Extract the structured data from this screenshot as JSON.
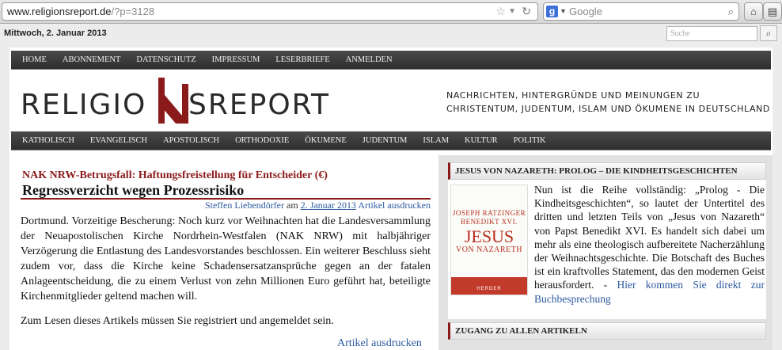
{
  "browser": {
    "url_host": "www.religionsreport.de",
    "url_path": "/?p=3128",
    "search_engine": "Google",
    "icons": [
      "star-icon",
      "dropdown-icon",
      "reload-icon",
      "google-icon",
      "magnifier-icon",
      "home-icon",
      "bookmark-icon"
    ]
  },
  "topbar": {
    "date": "Mittwoch, 2. Januar 2013",
    "search_placeholder": "Suche"
  },
  "nav_top": [
    "HOME",
    "ABONNEMENT",
    "DATENSCHUTZ",
    "IMPRESSUM",
    "LESERBRIEFE",
    "ANMELDEN"
  ],
  "logo": {
    "part1": "RELIGIO",
    "part2": "SREPORT",
    "mark": "N",
    "mark_color": "#8b1a1a"
  },
  "tagline": "Nachrichten, Hintergründe und Meinungen zu Christentum, Judentum, Islam und Ökumene in Deutschland",
  "nav_categories": [
    "KATHOLISCH",
    "EVANGELISCH",
    "APOSTOLISCH",
    "ORTHODOXIE",
    "ÖKUMENE",
    "JUDENTUM",
    "ISLAM",
    "KULTUR",
    "POLITIK"
  ],
  "article": {
    "kicker": "NAK NRW-Betrugsfall: Haftungsfreistellung für Entscheider (€)",
    "headline": "Regressverzicht wegen Prozessrisiko",
    "author": "Steffen Liebendörfer",
    "date_prefix": "am",
    "date": "2. Januar 2013",
    "print_label": "Artikel ausdrucken",
    "paragraph1": "Dortmund. Vorzeitige Bescherung: Noch kurz vor Weihnachten hat die Landesversammlung der Neuapostolischen Kirche Nordrhein-Westfalen (NAK NRW) mit halbjähriger Verzögerung die Entlastung des Landesvorstandes beschlossen. Ein weiterer Beschluss sieht zudem vor, dass die Kirche keine Schadensersatzansprüche gegen an der fatalen Anlageentscheidung, die zu einem Verlust von zehn Millionen Euro geführt hat, beteiligte Kirchenmitglieder geltend machen will.",
    "paragraph2": "Zum Lesen dieses Artikels müssen Sie registriert und angemeldet sein.",
    "print_label_bottom": "Artikel ausdrucken"
  },
  "sidebar": {
    "heading1": "JESUS VON NAZARETH: PROLOG – DIE KINDHEITSGESCHICHTEN",
    "book": {
      "author_line1": "JOSEPH RATZINGER",
      "author_line2": "BENEDIKT XVI.",
      "title": "JESUS",
      "subtitle": "VON NAZARETH",
      "publisher": "HERDER"
    },
    "text": "Nun ist die Reihe vollständig: „Prolog - Die Kindheitsgeschichten“, so lautet der Untertitel des dritten und letzten Teils von „Jesus von Nazareth“ von Papst Benedikt XVI. Es handelt sich dabei um mehr als eine theologisch aufbereitete Nacherzählung der Weihnachtsgeschichte. Die Botschaft des Buches ist ein kraftvolles Statement, das den modernen Geist herausfordert. - ",
    "link": "Hier kommen Sie direkt zur Buchbesprechung",
    "heading2": "ZUGANG ZU ALLEN ARTIKELN"
  }
}
